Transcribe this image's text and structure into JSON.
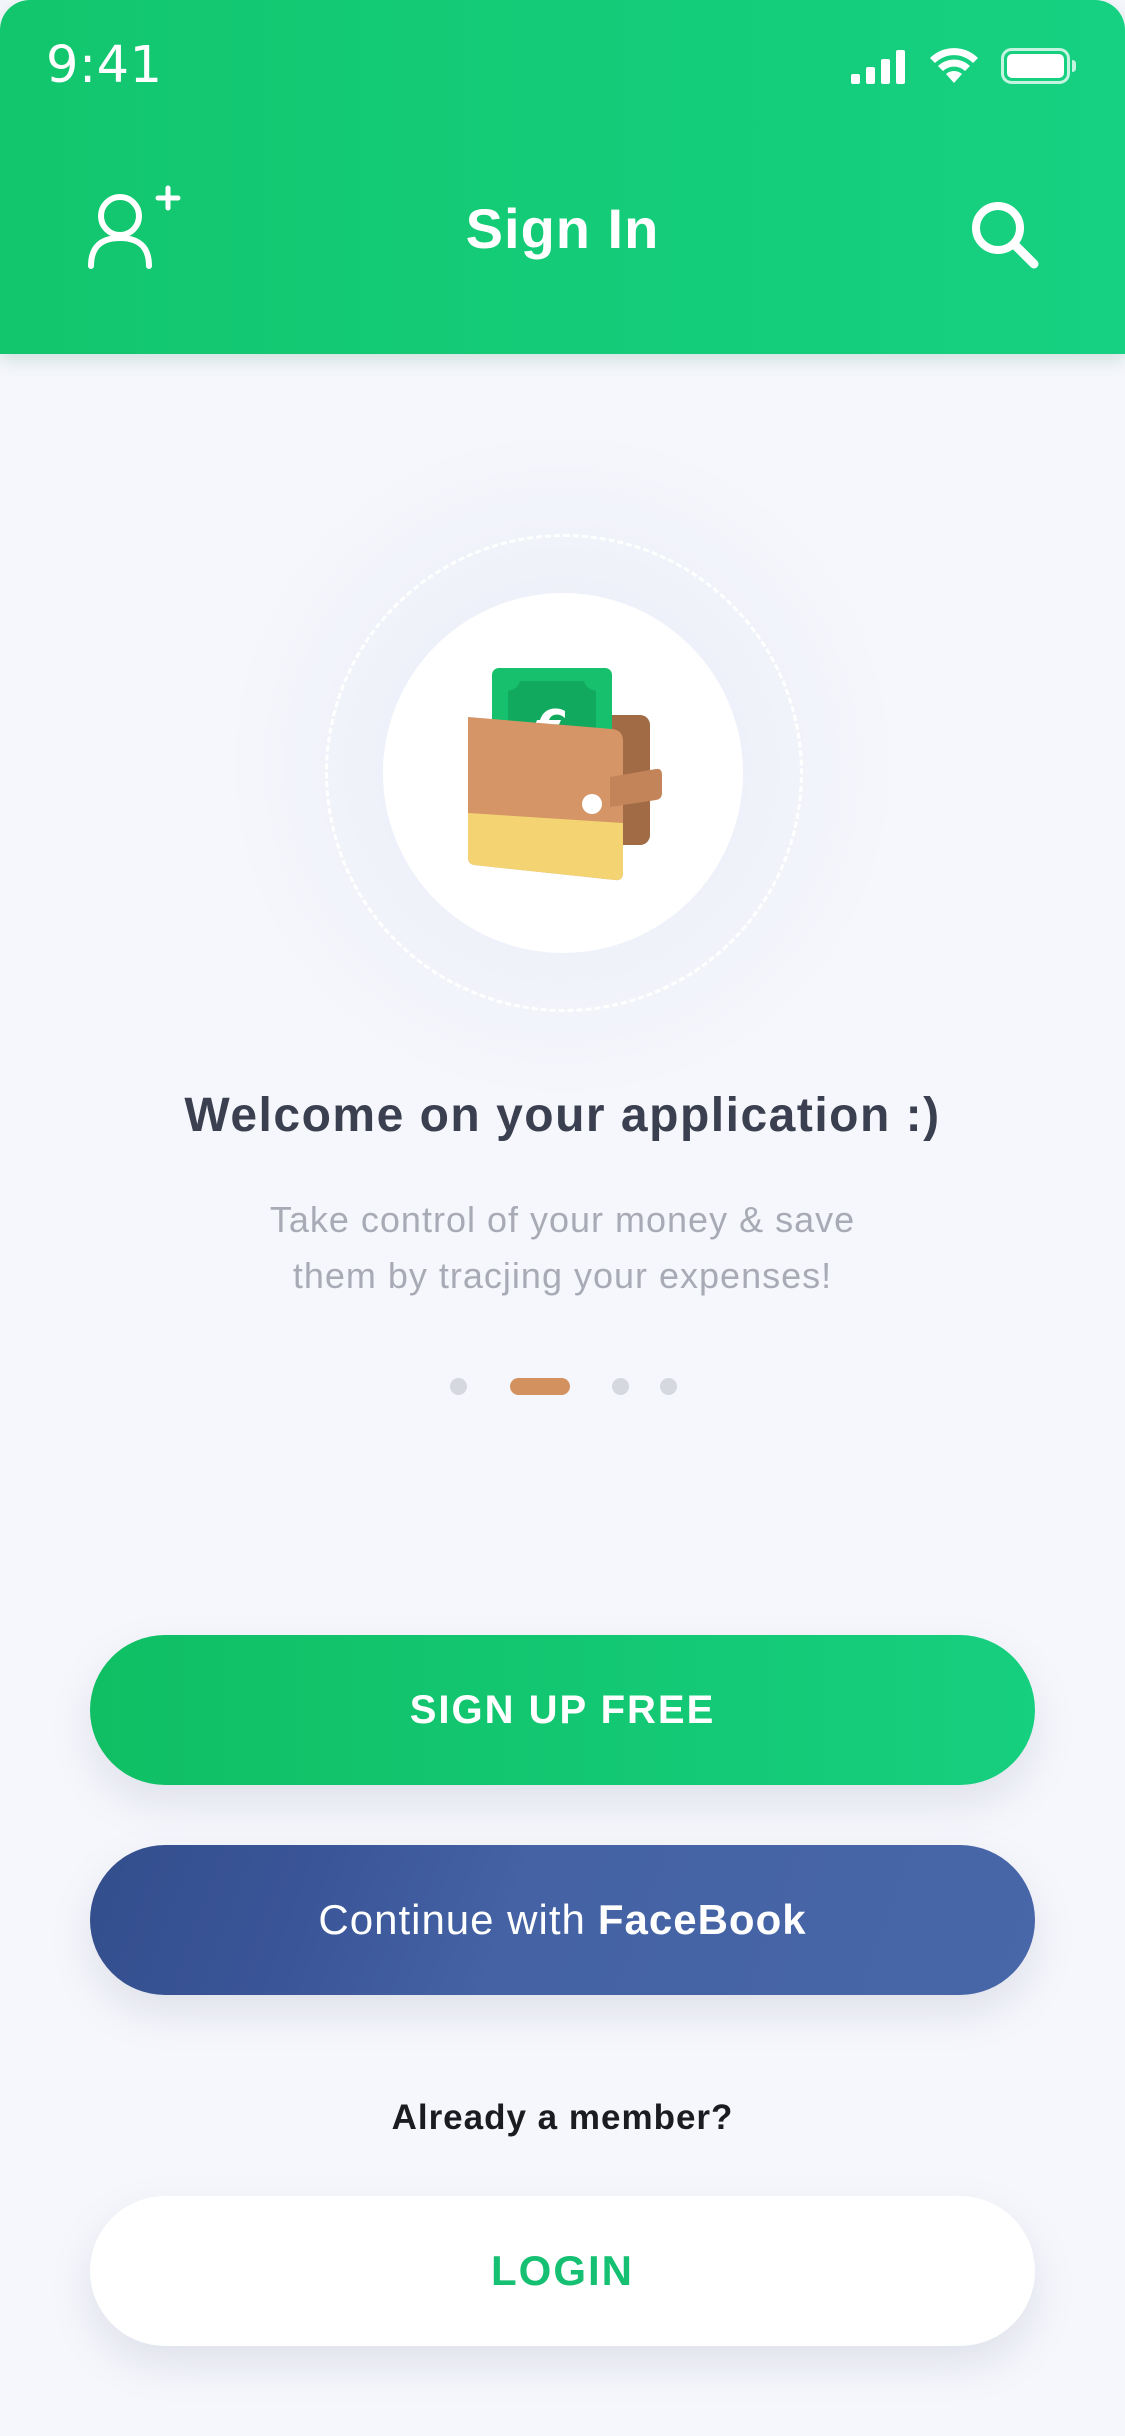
{
  "status_bar": {
    "time": "9:41",
    "icons": [
      "signal-icon",
      "wifi-icon",
      "battery-icon"
    ]
  },
  "header": {
    "title": "Sign In",
    "left_icon": "add-user-icon",
    "right_icon": "search-icon"
  },
  "illustration": {
    "icon": "wallet-icon",
    "currency_symbol": "€"
  },
  "welcome": {
    "title": "Welcome on your application :)",
    "subtitle_line1": "Take control of your money & save",
    "subtitle_line2": "them by tracjing your expenses!"
  },
  "pager": {
    "page_count": 4,
    "active_index": 1
  },
  "actions": {
    "signup_label": "SIGN UP FREE",
    "facebook_prefix": "Continue with",
    "facebook_brand": "FaceBook",
    "member_prompt": "Already a member?",
    "login_label": "LOGIN"
  },
  "colors": {
    "primary_green": "#14c877",
    "facebook_blue": "#4262a4",
    "accent_orange": "#d2915f",
    "background": "#f6f7fc",
    "title_text": "#3b4050",
    "subtitle_text": "#a8abb5"
  }
}
